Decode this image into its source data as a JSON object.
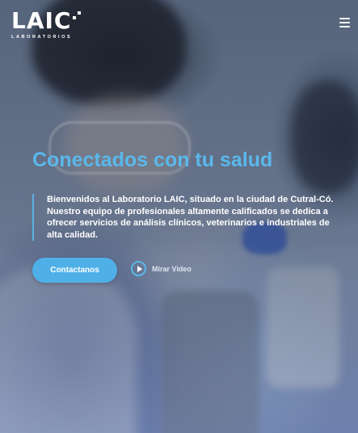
{
  "header": {
    "logo_text": "LAIC",
    "logo_subtitle": "LABORATORIOS",
    "menu_icon": "hamburger-menu-icon"
  },
  "hero": {
    "title": "Conectados con tu salud",
    "description": "Bienvenidos al Laboratorio LAIC, situado en la ciudad de Cutral-Có. Nuestro equipo de profesionales altamente calificados se dedica a ofrecer servicios de análisis clínicos, veterinarios e industriales de alta calidad.",
    "contact_label": "Contactanos",
    "video_label": "Mirar Video",
    "play_icon": "play-circle-icon"
  },
  "colors": {
    "accent": "#5ab8ea",
    "button": "#4fb0e8",
    "text": "#ffffff"
  }
}
